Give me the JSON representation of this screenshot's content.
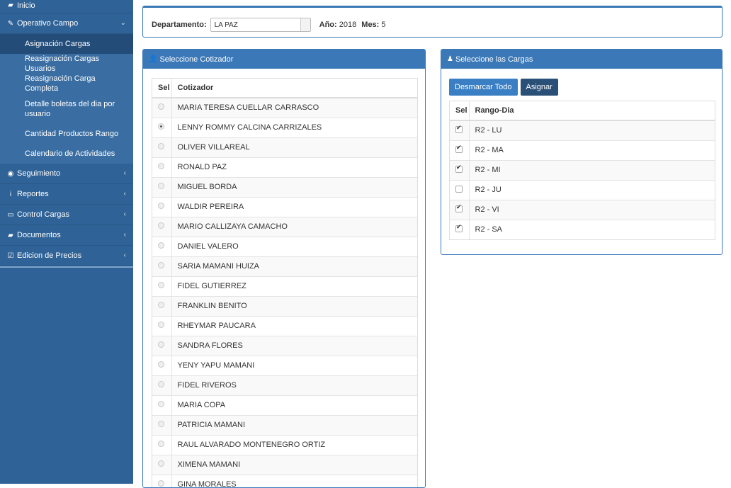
{
  "sidebar": {
    "inicio": "Inicio",
    "operativo": "Operativo Campo",
    "sub": [
      "Asignación Cargas",
      "Reasignación Cargas Usuarios",
      "Reasignación Carga Completa",
      "Detalle boletas del dia por usuario",
      "Cantidad Productos Rango",
      "Calendario de Actividades"
    ],
    "items": [
      "Seguimiento",
      "Reportes",
      "Control Cargas",
      "Documentos",
      "Edicion de Precios"
    ]
  },
  "top": {
    "departamento_label": "Departamento:",
    "departamento_value": "LA PAZ",
    "anio_label": "Año:",
    "anio_value": "2018",
    "mes_label": "Mes:",
    "mes_value": "5"
  },
  "cotizador": {
    "title": "Seleccione Cotizador",
    "col_sel": "Sel",
    "col_name": "Cotizador",
    "rows": [
      {
        "name": "MARIA TERESA CUELLAR CARRASCO",
        "selected": false
      },
      {
        "name": "LENNY ROMMY CALCINA CARRIZALES",
        "selected": true
      },
      {
        "name": "OLIVER VILLAREAL",
        "selected": false
      },
      {
        "name": "RONALD PAZ",
        "selected": false
      },
      {
        "name": "MIGUEL BORDA",
        "selected": false
      },
      {
        "name": "WALDIR PEREIRA",
        "selected": false
      },
      {
        "name": "MARIO CALLIZAYA CAMACHO",
        "selected": false
      },
      {
        "name": "DANIEL VALERO",
        "selected": false
      },
      {
        "name": "SARIA MAMANI HUIZA",
        "selected": false
      },
      {
        "name": "FIDEL GUTIERREZ",
        "selected": false
      },
      {
        "name": "FRANKLIN BENITO",
        "selected": false
      },
      {
        "name": "RHEYMAR PAUCARA",
        "selected": false
      },
      {
        "name": "SANDRA FLORES",
        "selected": false
      },
      {
        "name": "YENY YAPU MAMANI",
        "selected": false
      },
      {
        "name": "FIDEL RIVEROS",
        "selected": false
      },
      {
        "name": "MARIA COPA",
        "selected": false
      },
      {
        "name": "PATRICIA MAMANI",
        "selected": false
      },
      {
        "name": "RAUL ALVARADO MONTENEGRO ORTIZ",
        "selected": false
      },
      {
        "name": "XIMENA MAMANI",
        "selected": false
      },
      {
        "name": "GINA MORALES",
        "selected": false
      }
    ]
  },
  "cargas": {
    "title": "Seleccione las Cargas",
    "btn_desmarcar": "Desmarcar Todo",
    "btn_asignar": "Asignar",
    "col_sel": "Sel",
    "col_rango": "Rango-Dia",
    "rows": [
      {
        "label": "R2 - LU",
        "checked": true
      },
      {
        "label": "R2 - MA",
        "checked": true
      },
      {
        "label": "R2 - MI",
        "checked": true
      },
      {
        "label": "R2 - JU",
        "checked": false
      },
      {
        "label": "R2 - VI",
        "checked": true
      },
      {
        "label": "R2 - SA",
        "checked": true
      }
    ]
  }
}
